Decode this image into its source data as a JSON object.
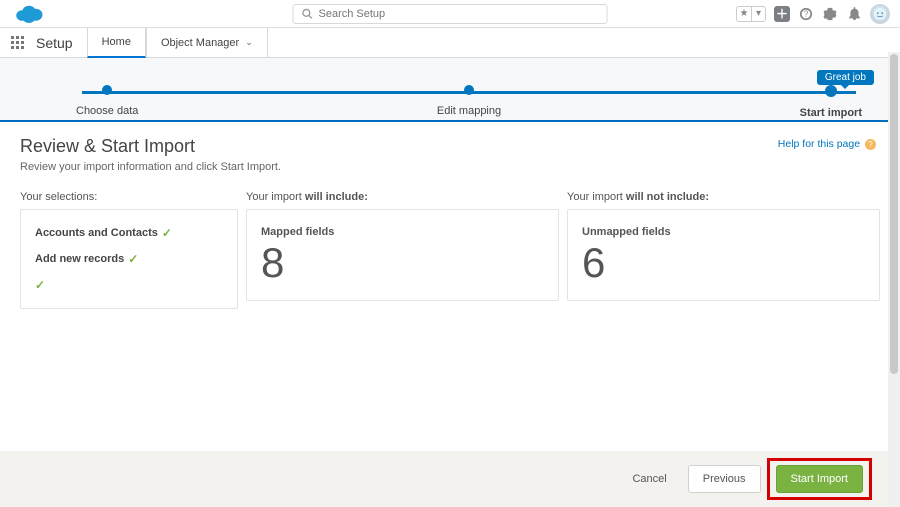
{
  "header": {
    "search_placeholder": "Search Setup"
  },
  "nav": {
    "app_title": "Setup",
    "tabs": [
      {
        "label": "Home",
        "active": true
      },
      {
        "label": "Object Manager",
        "active": false
      }
    ]
  },
  "wizard": {
    "tooltip": "Great job",
    "steps": [
      {
        "label": "Choose data",
        "active": false
      },
      {
        "label": "Edit mapping",
        "active": false
      },
      {
        "label": "Start import",
        "active": true
      }
    ]
  },
  "page": {
    "title": "Review & Start Import",
    "subtitle": "Review your import information and click Start Import.",
    "help_link": "Help for this page"
  },
  "selections": {
    "title": "Your selections:",
    "items": [
      "Accounts and Contacts",
      "Add new records"
    ]
  },
  "include": {
    "title_prefix": "Your import ",
    "title_bold": "will include:",
    "stat_label": "Mapped fields",
    "stat_value": "8"
  },
  "exclude": {
    "title_prefix": "Your import ",
    "title_bold": "will not include:",
    "stat_label": "Unmapped fields",
    "stat_value": "6"
  },
  "footer": {
    "cancel": "Cancel",
    "previous": "Previous",
    "start": "Start Import"
  }
}
